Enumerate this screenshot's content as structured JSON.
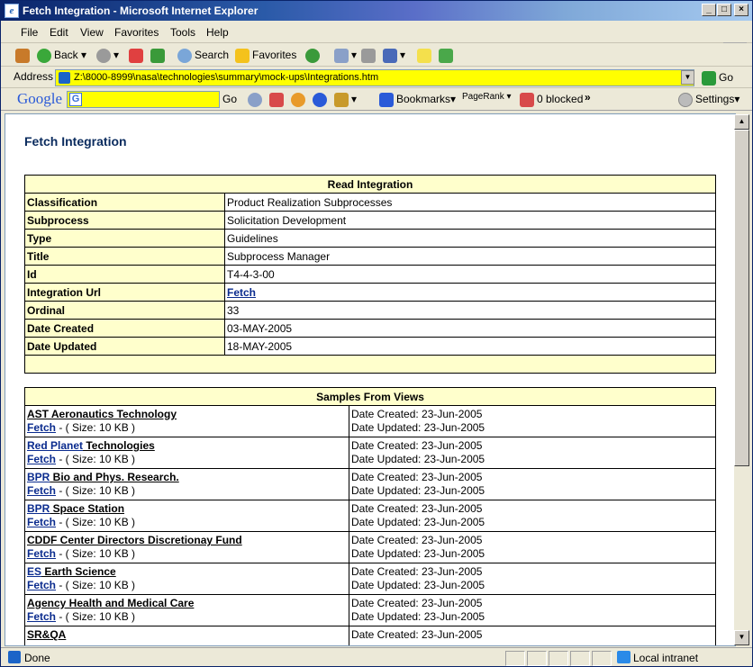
{
  "window": {
    "title": "Fetch Integration - Microsoft Internet Explorer",
    "min": "_",
    "max": "□",
    "close": "×"
  },
  "menu": [
    "File",
    "Edit",
    "View",
    "Favorites",
    "Tools",
    "Help"
  ],
  "toolbar": {
    "back": "Back",
    "search": "Search",
    "favorites": "Favorites"
  },
  "address": {
    "label": "Address",
    "url": "Z:\\8000-8999\\nasa\\technologies\\summary\\mock-ups\\Integrations.htm",
    "go": "Go"
  },
  "google": {
    "logo": "Google",
    "go": "Go",
    "bookmarks": "Bookmarks",
    "pagerank": "PageRank",
    "blocked": "0 blocked",
    "more": "»",
    "settings": "Settings"
  },
  "page": {
    "title": "Fetch Integration"
  },
  "read": {
    "header": "Read Integration",
    "rows": [
      {
        "label": "Classification",
        "value": "Product Realization Subprocesses"
      },
      {
        "label": "Subprocess",
        "value": " Solicitation Development"
      },
      {
        "label": "Type",
        "value": "Guidelines"
      },
      {
        "label": "Title",
        "value": " Subprocess Manager"
      },
      {
        "label": "Id",
        "value": "T4-4-3-00"
      },
      {
        "label": "Integration Url",
        "value": "Fetch",
        "link": true
      },
      {
        "label": "Ordinal",
        "value": "33"
      },
      {
        "label": "Date Created",
        "value": "03-MAY-2005"
      },
      {
        "label": "Date Updated",
        "value": "18-MAY-2005"
      }
    ]
  },
  "samples": {
    "header": "Samples From Views",
    "fetch": "Fetch",
    "size": " - ( Size: 10 KB )",
    "created": "Date Created: 23-Jun-2005",
    "updated": "Date Updated: 23-Jun-2005",
    "items": [
      {
        "prefix": "",
        "name": "AST Aeronautics Technology"
      },
      {
        "prefix": "Red Planet",
        "name": " Technologies"
      },
      {
        "prefix": "BPR",
        "name": " Bio and Phys. Research."
      },
      {
        "prefix": "BPR",
        "name": " Space Station"
      },
      {
        "prefix": "",
        "name": "CDDF Center Directors Discretionay Fund"
      },
      {
        "prefix": "ES",
        "name": " Earth Science"
      },
      {
        "prefix": "",
        "name": "Agency Health and Medical Care "
      },
      {
        "prefix": "",
        "name": "SR&QA "
      }
    ]
  },
  "status": {
    "text": "Done",
    "zone": "Local intranet"
  }
}
